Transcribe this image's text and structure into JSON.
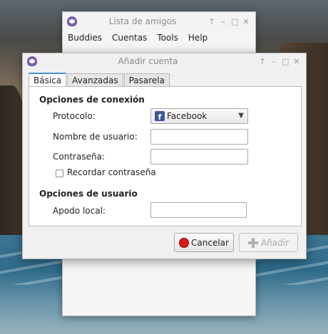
{
  "buddy_window": {
    "title": "Lista de amigos",
    "controls": [
      "↑",
      "–",
      "□",
      "✕"
    ],
    "menu": [
      "Buddies",
      "Cuentas",
      "Tools",
      "Help"
    ]
  },
  "dialog": {
    "title": "Añadir cuenta",
    "controls": [
      "↑",
      "–",
      "□",
      "✕"
    ],
    "tabs": [
      "Básica",
      "Avanzadas",
      "Pasarela"
    ],
    "active_tab": "Básica",
    "connection_section": "Opciones de conexión",
    "protocol_label": "Protocolo:",
    "protocol_value": "Facebook",
    "username_label": "Nombre de usuario:",
    "username_value": "",
    "password_label": "Contraseña:",
    "password_value": "",
    "remember_label": "Recordar contraseña",
    "remember_checked": false,
    "user_section": "Opciones de usuario",
    "alias_label": "Apodo local:",
    "alias_value": "",
    "cancel_label": "Cancelar",
    "add_label": "Añadir"
  },
  "colors": {
    "facebook": "#3b5998",
    "cancel_icon": "#d91a1a",
    "tab_accent": "#4a90d9"
  }
}
